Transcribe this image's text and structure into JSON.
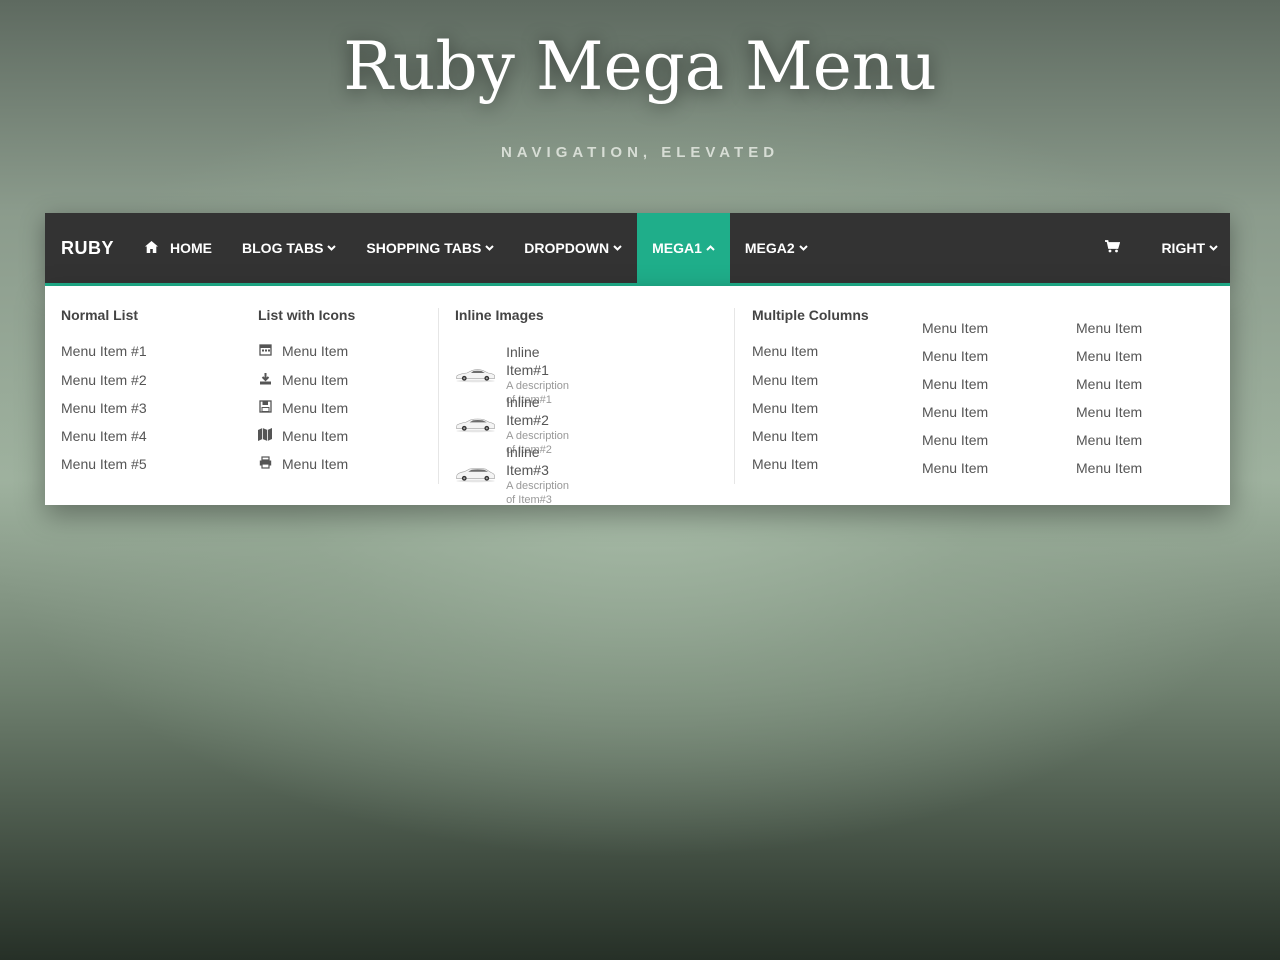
{
  "hero": {
    "title": "Ruby Mega Menu",
    "subtitle": "NAVIGATION, ELEVATED"
  },
  "navbar": {
    "brand": "RUBY",
    "accent_color": "#1fae8a",
    "bar_color": "#333333",
    "items": [
      {
        "label": "HOME",
        "icon": "home-icon",
        "has_caret": false
      },
      {
        "label": "BLOG TABS",
        "has_caret": true
      },
      {
        "label": "SHOPPING TABS",
        "has_caret": true
      },
      {
        "label": "DROPDOWN",
        "has_caret": true
      },
      {
        "label": "MEGA1",
        "has_caret": true,
        "active": true
      },
      {
        "label": "MEGA2",
        "has_caret": true
      }
    ],
    "cart_icon": "shopping-cart-icon",
    "right_label": "RIGHT"
  },
  "mega": {
    "normal_list": {
      "title": "Normal List",
      "items": [
        "Menu Item #1",
        "Menu Item #2",
        "Menu Item #3",
        "Menu Item #4",
        "Menu Item #5"
      ]
    },
    "icon_list": {
      "title": "List with Icons",
      "items": [
        {
          "icon": "calendar-icon",
          "label": "Menu Item"
        },
        {
          "icon": "download-icon",
          "label": "Menu Item"
        },
        {
          "icon": "save-icon",
          "label": "Menu Item"
        },
        {
          "icon": "map-icon",
          "label": "Menu Item"
        },
        {
          "icon": "print-icon",
          "label": "Menu Item"
        }
      ]
    },
    "inline_images": {
      "title": "Inline Images",
      "items": [
        {
          "label": "Inline Item#1",
          "desc": "A description of Item#1"
        },
        {
          "label": "Inline Item#2",
          "desc": "A description of Item#2"
        },
        {
          "label": "Inline Item#3",
          "desc": "A description of Item#3"
        }
      ]
    },
    "multi_columns": {
      "title": "Multiple Columns",
      "col1": [
        "Menu Item",
        "Menu Item",
        "Menu Item",
        "Menu Item",
        "Menu Item"
      ],
      "col2": [
        "Menu Item",
        "Menu Item",
        "Menu Item",
        "Menu Item",
        "Menu Item",
        "Menu Item"
      ],
      "col3": [
        "Menu Item",
        "Menu Item",
        "Menu Item",
        "Menu Item",
        "Menu Item",
        "Menu Item"
      ]
    }
  }
}
